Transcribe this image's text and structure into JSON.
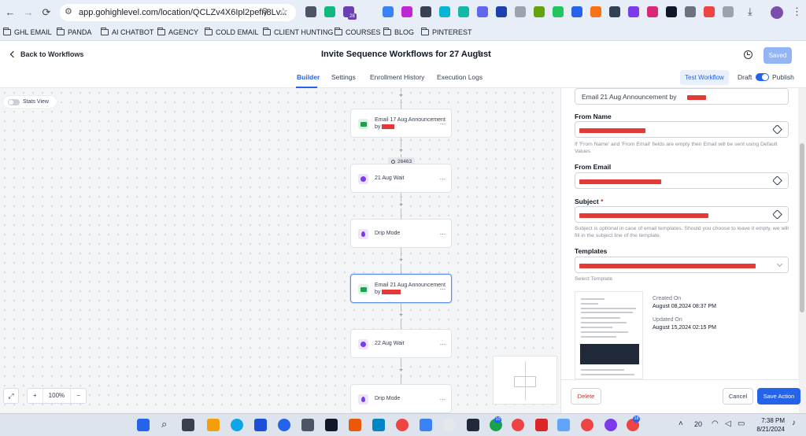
{
  "browser": {
    "url": "app.gohighlevel.com/location/QCLZv4X6Ipl2pefn8Lv...",
    "extension_badge": "28",
    "bookmarks": [
      "GHL EMAIL",
      "PANDA",
      "AI CHATBOT",
      "AGENCY",
      "COLD EMAIL",
      "CLIENT HUNTING",
      "COURSES",
      "BLOG",
      "PINTEREST"
    ]
  },
  "header": {
    "back_label": "Back to Workflows",
    "title": "Invite Sequence Workflows for 27 August",
    "saved_label": "Saved"
  },
  "tabs": {
    "items": [
      "Builder",
      "Settings",
      "Enrollment History",
      "Execution Logs"
    ],
    "active": "Builder",
    "test_workflow": "Test Workflow",
    "draft": "Draft",
    "publish": "Publish"
  },
  "canvas": {
    "stats_view": "Stats View",
    "count_chip": "26463",
    "nodes": [
      {
        "type": "email",
        "label": "Email 17 Aug Announcement",
        "label2": "by",
        "redacted": true
      },
      {
        "type": "wait",
        "label": "21 Aug Wait"
      },
      {
        "type": "drip",
        "label": "Drip Mode"
      },
      {
        "type": "email",
        "label": "Email 21 Aug Announcement",
        "label2": "by",
        "redacted": true,
        "selected": true
      },
      {
        "type": "wait",
        "label": "22 Aug Wait"
      },
      {
        "type": "drip",
        "label": "Drip Mode"
      }
    ],
    "zoom": "100%",
    "zoom_in": "+",
    "zoom_out": "−"
  },
  "panel": {
    "action_name": "Email 21 Aug Announcement by",
    "from_name_label": "From Name",
    "from_name_hint": "If 'From Name' and 'From Email' fields are empty then Email will be sent using Default Values",
    "from_email_label": "From Email",
    "subject_label": "Subject",
    "subject_required": "*",
    "subject_hint": "Subject is optional in case of email templates. Should you choose to leave it empty, we will fill in the subject line of the template.",
    "templates_label": "Templates",
    "templates_hint": "Select Template",
    "created_label": "Created On",
    "created_value": "August 08,2024 08:37 PM",
    "updated_label": "Updated On",
    "updated_value": "August 15,2024 02:15 PM",
    "delete": "Delete",
    "cancel": "Cancel",
    "save": "Save Action"
  },
  "taskbar": {
    "temperature": "20",
    "time": "7:38 PM",
    "date": "8/21/2024",
    "badge_a": "10",
    "badge_b": "18"
  },
  "colors": {
    "accent": "#2563eb",
    "redaction": "#e53935",
    "email_icon": "#16a34a",
    "wait_icon": "#7c3aed"
  }
}
